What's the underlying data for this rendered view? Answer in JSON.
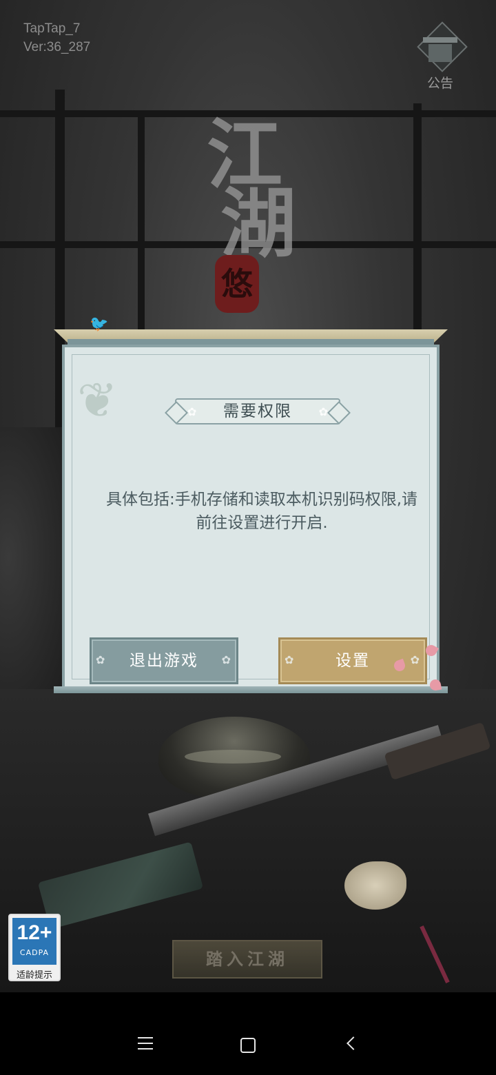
{
  "status": {
    "channel": "TapTap_7",
    "version": "Ver:36_287"
  },
  "notice": {
    "label": "公告",
    "icon": "pavilion-icon"
  },
  "logo": {
    "char1": "江",
    "char2": "湖",
    "seal": "悠"
  },
  "dialog": {
    "title": "需要权限",
    "message": "具体包括:手机存储和读取本机识别码权限,请前往设置进行开启.",
    "exit_label": "退出游戏",
    "settings_label": "设置"
  },
  "age_rating": {
    "rating": "12+",
    "org": "CADPA",
    "tip": "适龄提示"
  },
  "enter_button": {
    "label": "踏入江湖"
  },
  "navbar": {
    "menu_icon": "menu-icon",
    "home_icon": "home-icon",
    "back_icon": "back-icon"
  },
  "colors": {
    "dialog_bg": "#dce6e6",
    "exit_button": "#859c9f",
    "settings_button": "#c0a56f",
    "text": "#4b5b60"
  }
}
